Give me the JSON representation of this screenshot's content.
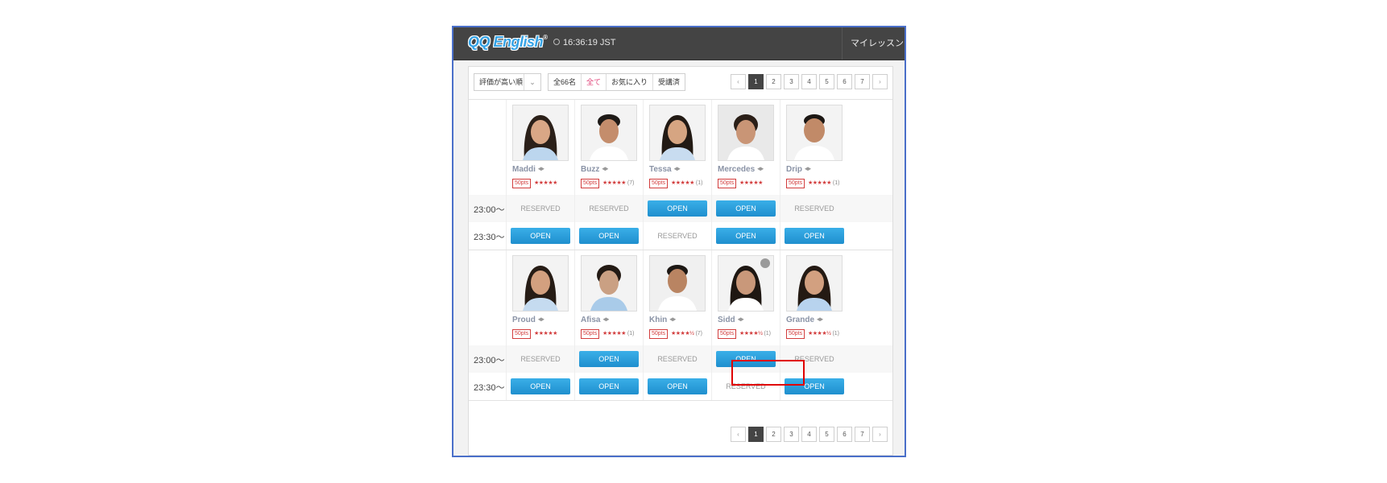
{
  "header": {
    "logo": "QQ English",
    "logo_mark": "®",
    "time": "16:36:19 JST",
    "my_lesson": "マイレッスン"
  },
  "controls": {
    "sort": "評価が高い順",
    "filters": [
      "全66名",
      "全て",
      "お気に入り",
      "受講済"
    ],
    "active_filter": "全て"
  },
  "pagination": {
    "prev": "‹",
    "next": "›",
    "pages": [
      "1",
      "2",
      "3",
      "4",
      "5",
      "6",
      "7"
    ],
    "current": "1"
  },
  "slots": [
    "23:00～",
    "23:30～"
  ],
  "points_label": "50pts",
  "open_label": "OPEN",
  "reserved_label": "RESERVED",
  "teachers_row1": [
    {
      "name": "Maddi",
      "stars": "★★★★★",
      "count": "",
      "slot_2300": "RESERVED",
      "slot_2330": "OPEN"
    },
    {
      "name": "Buzz",
      "stars": "★★★★★",
      "count": "(7)",
      "slot_2300": "RESERVED",
      "slot_2330": "OPEN"
    },
    {
      "name": "Tessa",
      "stars": "★★★★★",
      "count": "(1)",
      "slot_2300": "OPEN",
      "slot_2330": "RESERVED"
    },
    {
      "name": "Mercedes",
      "stars": "★★★★★",
      "count": "",
      "slot_2300": "OPEN",
      "slot_2330": "OPEN"
    },
    {
      "name": "Drip",
      "stars": "★★★★★",
      "count": "(1)",
      "slot_2300": "RESERVED",
      "slot_2330": "OPEN"
    }
  ],
  "teachers_row2": [
    {
      "name": "Proud",
      "stars": "★★★★★",
      "count": "",
      "slot_2300": "RESERVED",
      "slot_2330": "OPEN"
    },
    {
      "name": "Afisa",
      "stars": "★★★★★",
      "count": "(1)",
      "slot_2300": "OPEN",
      "slot_2330": "OPEN"
    },
    {
      "name": "Khin",
      "stars": "★★★★½",
      "count": "(7)",
      "slot_2300": "RESERVED",
      "slot_2330": "OPEN"
    },
    {
      "name": "Sidd",
      "stars": "★★★★½",
      "count": "(1)",
      "slot_2300": "OPEN",
      "slot_2330": "RESERVED"
    },
    {
      "name": "Grande",
      "stars": "★★★★½",
      "count": "(1)",
      "slot_2300": "RESERVED",
      "slot_2330": "OPEN"
    }
  ],
  "colors": {
    "accent": "#2a9fdc",
    "header": "#444444",
    "pts": "#d23d3d",
    "highlight": "#e00000"
  }
}
